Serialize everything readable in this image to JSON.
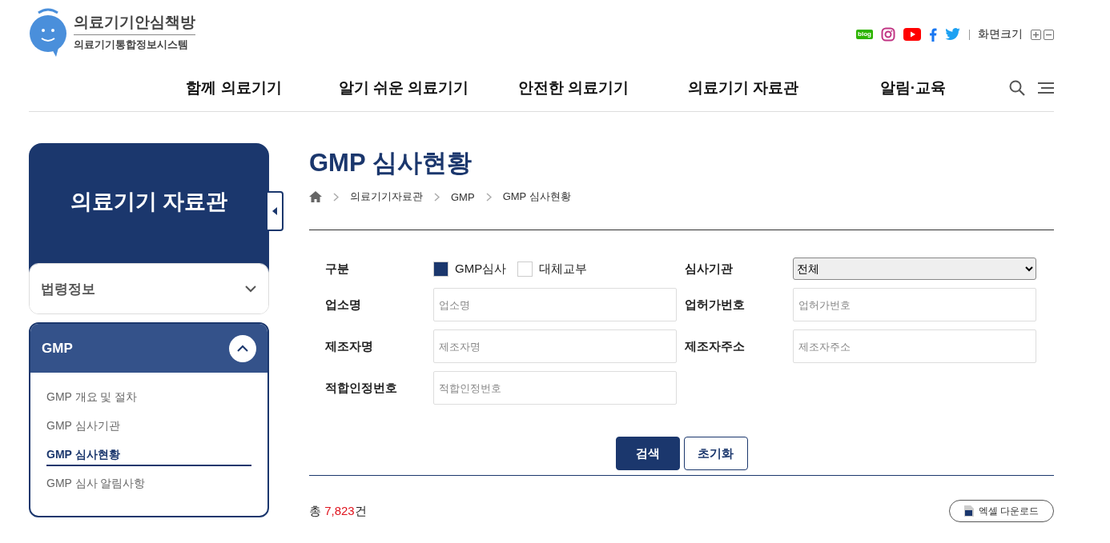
{
  "logo": {
    "title": "의료기기안심책방",
    "subtitle": "의료기기통합정보시스템"
  },
  "social": [
    {
      "kind": "blog",
      "label": "blog"
    },
    {
      "kind": "instagram"
    },
    {
      "kind": "youtube"
    },
    {
      "kind": "facebook"
    },
    {
      "kind": "twitter"
    }
  ],
  "font_size": {
    "label": "화면크기"
  },
  "nav": [
    "함께 의료기기",
    "알기 쉬운 의료기기",
    "안전한 의료기기",
    "의료기기 자료관",
    "알림·교육"
  ],
  "sidebar": {
    "title": "의료기기 자료관",
    "groups": [
      {
        "label": "법령정보",
        "expanded": false
      },
      {
        "label": "GMP",
        "expanded": true,
        "children": [
          {
            "label": "GMP 개요 및 절차",
            "selected": false
          },
          {
            "label": "GMP 심사기관",
            "selected": false
          },
          {
            "label": "GMP 심사현황",
            "selected": true
          },
          {
            "label": "GMP 심사 알림사항",
            "selected": false
          }
        ]
      }
    ]
  },
  "page_title": "GMP 심사현황",
  "breadcrumb": [
    "의료기기자료관",
    "GMP",
    "GMP 심사현황"
  ],
  "form": {
    "type_label": "구분",
    "options": [
      {
        "label": "GMP심사",
        "checked": true
      },
      {
        "label": "대체교부",
        "checked": false
      }
    ],
    "agency": {
      "label": "심사기관",
      "value": "전체"
    },
    "fields": [
      {
        "label": "업소명",
        "placeholder": "업소명"
      },
      {
        "label": "업허가번호",
        "placeholder": "업허가번호"
      },
      {
        "label": "제조자명",
        "placeholder": "제조자명"
      },
      {
        "label": "제조자주소",
        "placeholder": "제조자주소"
      },
      {
        "label": "적합인정번호",
        "placeholder": "적합인정번호"
      }
    ]
  },
  "buttons": {
    "search": "검색",
    "reset": "초기화"
  },
  "total": {
    "prefix": "총",
    "count": "7,823",
    "suffix": "건"
  },
  "excel_button": "엑셀 다운로드"
}
